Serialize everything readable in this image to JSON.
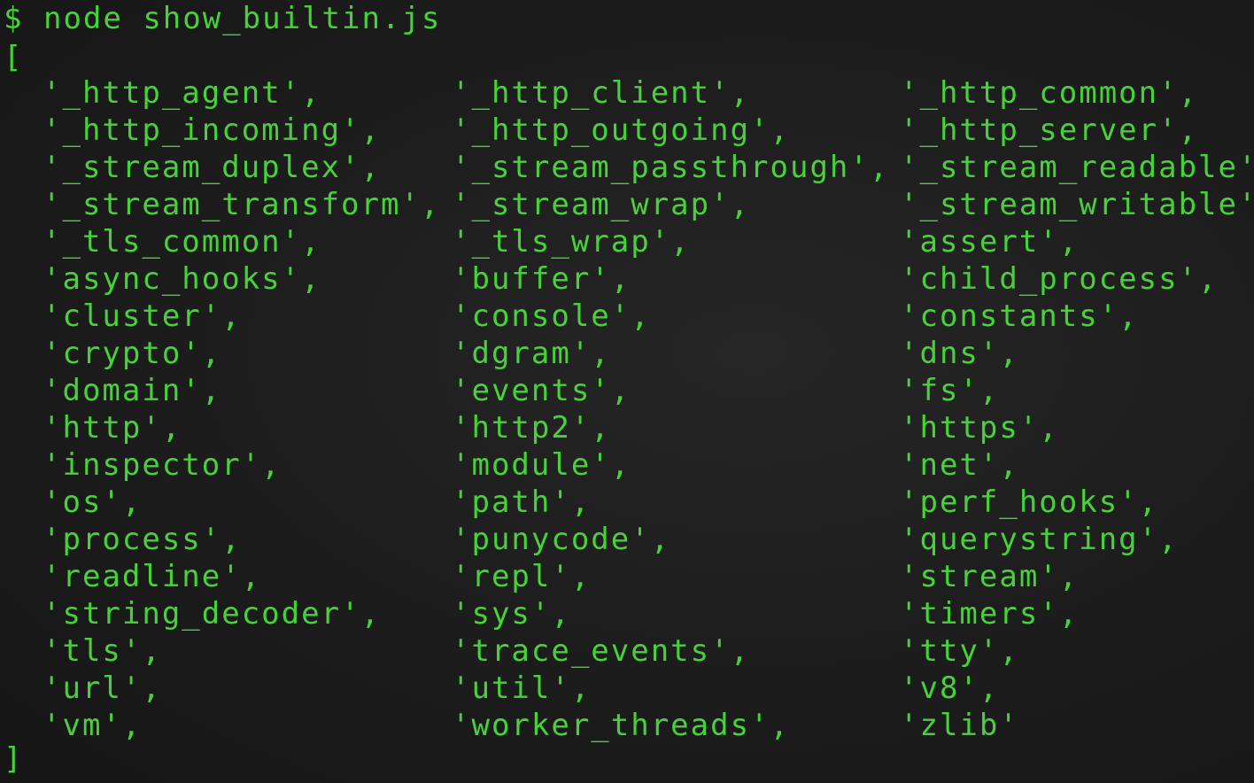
{
  "terminal": {
    "prompt_symbol": "$",
    "command": "node show_builtin.js",
    "open_bracket": "[",
    "close_bracket": "]",
    "text_color": "#46d338",
    "background_color": "#1d1d1d",
    "rows": [
      [
        "'_http_agent',",
        "'_http_client',",
        "'_http_common',"
      ],
      [
        "'_http_incoming',",
        "'_http_outgoing',",
        "'_http_server',"
      ],
      [
        "'_stream_duplex',",
        "'_stream_passthrough',",
        "'_stream_readable'"
      ],
      [
        "'_stream_transform',",
        "'_stream_wrap',",
        "'_stream_writable'"
      ],
      [
        "'_tls_common',",
        "'_tls_wrap',",
        "'assert',"
      ],
      [
        "'async_hooks',",
        "'buffer',",
        "'child_process',"
      ],
      [
        "'cluster',",
        "'console',",
        "'constants',"
      ],
      [
        "'crypto',",
        "'dgram',",
        "'dns',"
      ],
      [
        "'domain',",
        "'events',",
        "'fs',"
      ],
      [
        "'http',",
        "'http2',",
        "'https',"
      ],
      [
        "'inspector',",
        "'module',",
        "'net',"
      ],
      [
        "'os',",
        "'path',",
        "'perf_hooks',"
      ],
      [
        "'process',",
        "'punycode',",
        "'querystring',"
      ],
      [
        "'readline',",
        "'repl',",
        "'stream',"
      ],
      [
        "'string_decoder',",
        "'sys',",
        "'timers',"
      ],
      [
        "'tls',",
        "'trace_events',",
        "'tty',"
      ],
      [
        "'url',",
        "'util',",
        "'v8',"
      ],
      [
        "'vm',",
        "'worker_threads',",
        "'zlib'"
      ]
    ]
  }
}
